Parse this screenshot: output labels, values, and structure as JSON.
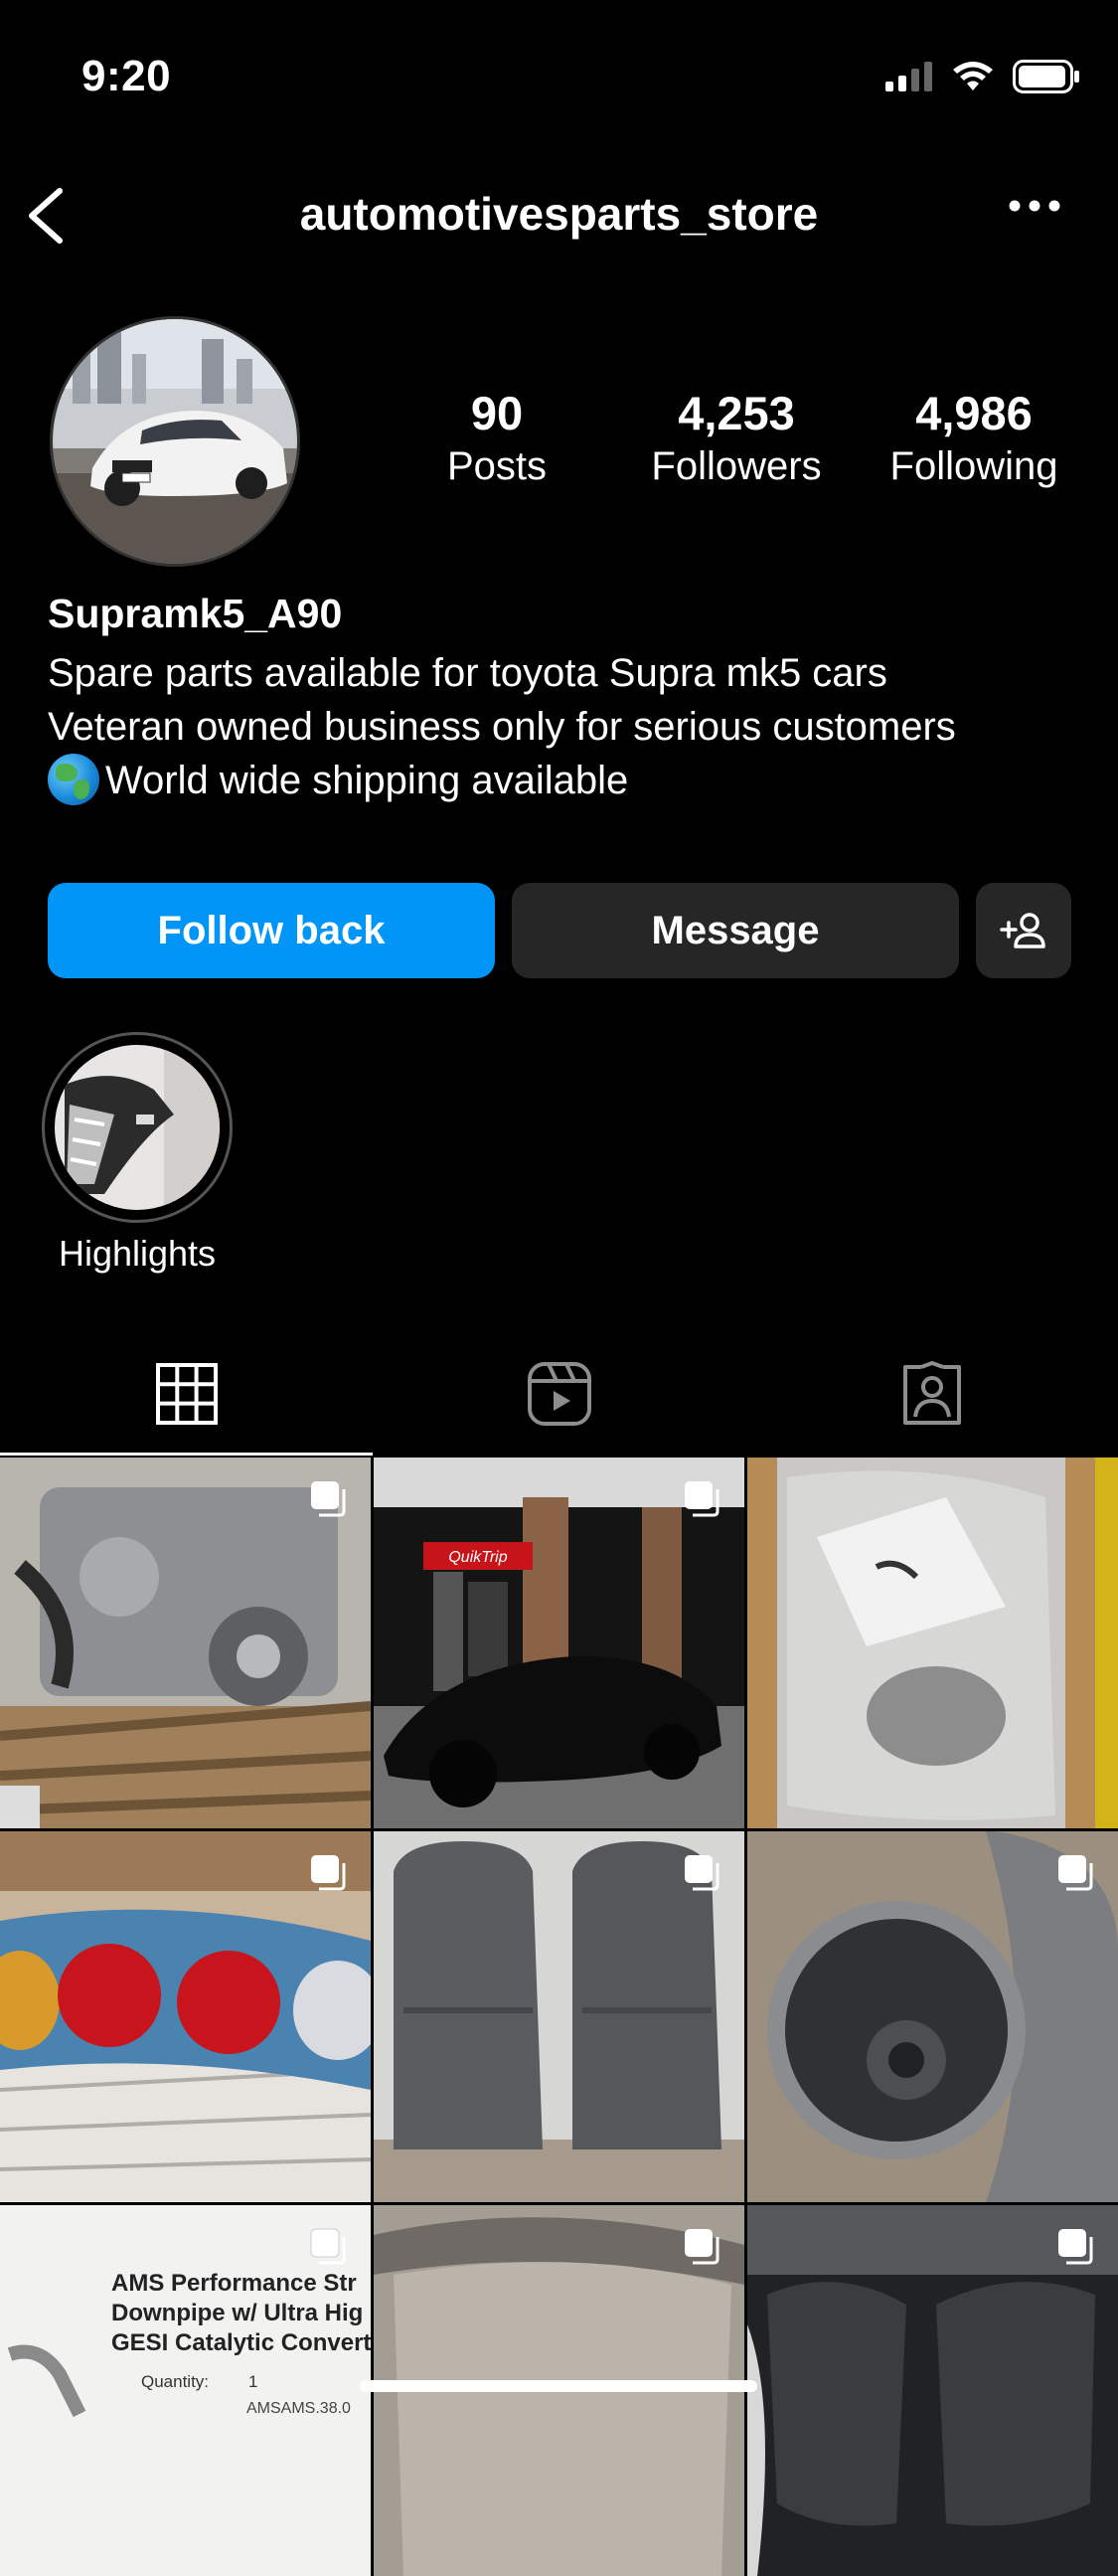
{
  "status_bar": {
    "time": "9:20"
  },
  "header": {
    "username": "automotivesparts_store"
  },
  "profile": {
    "stats": [
      {
        "value": "90",
        "label": "Posts"
      },
      {
        "value": "4,253",
        "label": "Followers"
      },
      {
        "value": "4,986",
        "label": "Following"
      }
    ],
    "name": "Supramk5_A90",
    "bio": [
      "Spare parts available for toyota Supra mk5 cars",
      "Veteran owned business only for serious customers",
      "World wide shipping available"
    ],
    "bio_emoji": "globe-icon"
  },
  "actions": {
    "follow_back": "Follow back",
    "message": "Message"
  },
  "highlights": [
    {
      "label": "Highlights"
    }
  ],
  "tabs": [
    "grid-icon",
    "reels-icon",
    "tagged-icon"
  ],
  "grid_posts": [
    {
      "subject": "engine on pallet"
    },
    {
      "subject": "black Supra at QuikTrip gas station",
      "sign_text": "QuikTrip"
    },
    {
      "subject": "part in plastic bag"
    },
    {
      "subject": "tail lights"
    },
    {
      "subject": "grey seats"
    },
    {
      "subject": "downpipe pipe opening"
    },
    {
      "subject": "invoice",
      "lines": [
        "AMS Performance Str",
        "Downpipe w/ Ultra Hig",
        "GESI Catalytic Convert",
        "Quantity:",
        "1",
        "AMSAMS.38.0"
      ]
    },
    {
      "subject": "metal panel"
    },
    {
      "subject": "black mirror covers"
    }
  ],
  "colors": {
    "accent": "#0095f6",
    "button_dark": "#262626",
    "background": "#000000"
  }
}
